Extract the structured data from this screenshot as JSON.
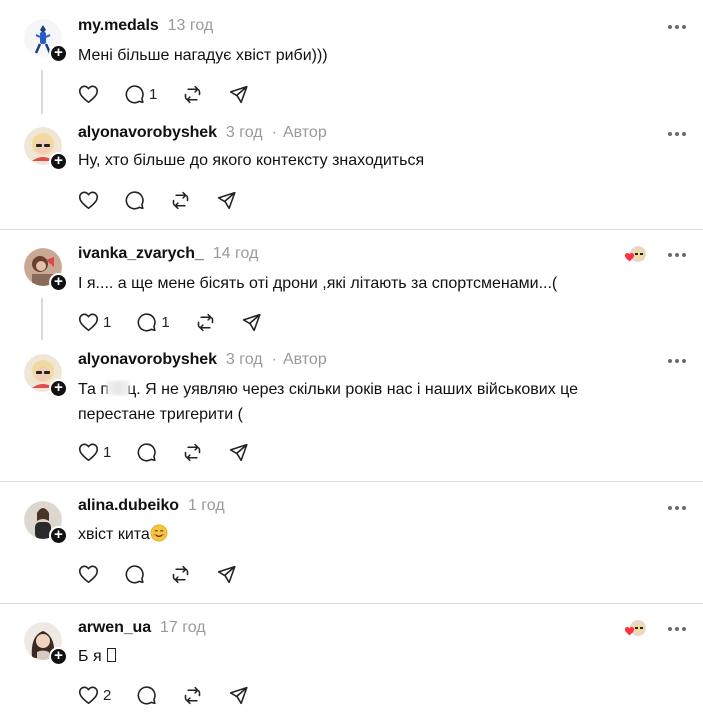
{
  "threads": [
    {
      "comments": [
        {
          "username": "my.medals",
          "time": "13 год",
          "author_tag": "",
          "text": [
            "Мені більше нагадує хвіст риби)))"
          ],
          "likes": "",
          "replies": "1"
        },
        {
          "username": "alyonavorobyshek",
          "time": "3 год",
          "author_tag": "Автор",
          "text": [
            "Ну, хто більше до якого контексту знаходиться"
          ],
          "likes": "",
          "replies": ""
        }
      ]
    },
    {
      "comments": [
        {
          "username": "ivanka_zvarych_",
          "time": "14 год",
          "author_tag": "",
          "text": [
            "І я.... а ще мене бісять оті дрони ,які літають за спортсменами...("
          ],
          "likes": "1",
          "replies": "1"
        },
        {
          "username": "alyonavorobyshek",
          "time": "3 год",
          "author_tag": "Автор",
          "text_part_a": "Та п",
          "text_part_b": "ц. Я не уявляю через скільки років нас і наших військових це",
          "text_line2": "перестане тригерити (",
          "likes": "1",
          "replies": ""
        }
      ]
    },
    {
      "comments": [
        {
          "username": "alina.dubeiko",
          "time": "1 год",
          "author_tag": "",
          "text": [
            "хвіст кита"
          ],
          "emoji": "smiling-face-emoji",
          "likes": "",
          "replies": ""
        }
      ]
    },
    {
      "comments": [
        {
          "username": "arwen_ua",
          "time": "17 год",
          "author_tag": "",
          "text": [
            "Б я"
          ],
          "likes": "2",
          "replies": ""
        }
      ]
    }
  ],
  "colors": {
    "accent_heart": "#ff3040",
    "muted": "#9a9a9a",
    "divider": "#dbdbdb"
  }
}
